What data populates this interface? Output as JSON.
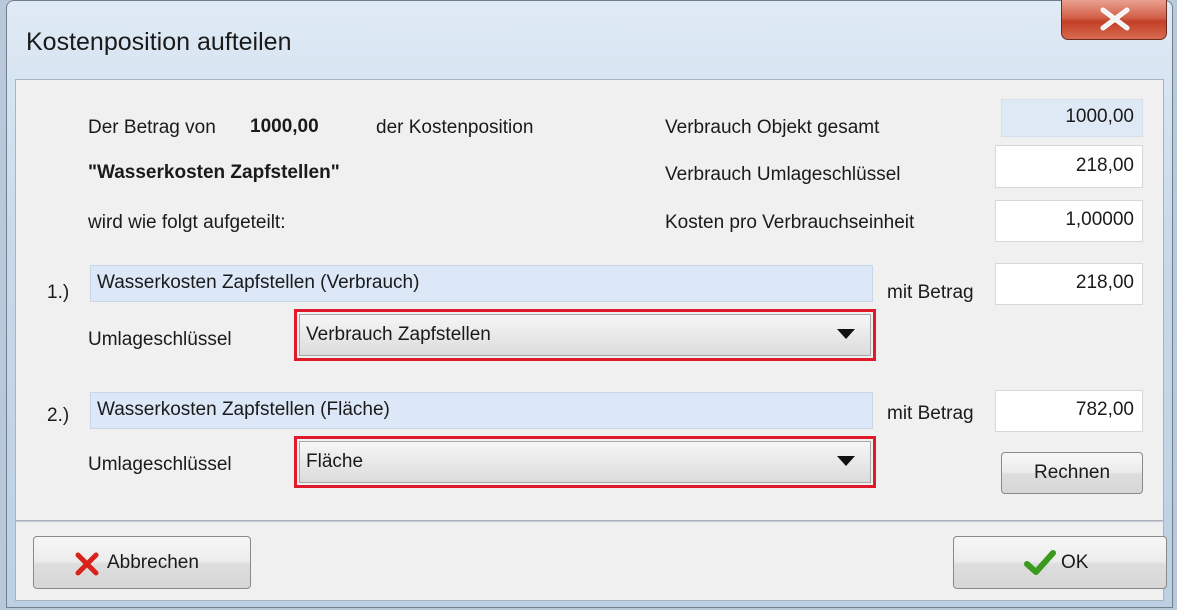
{
  "window": {
    "title": "Kostenposition aufteilen"
  },
  "intro": {
    "line1_prefix": "Der Betrag von",
    "amount": "1000,00",
    "line1_suffix": "der Kostenposition",
    "position_name": "\"Wasserkosten Zapfstellen\"",
    "line3": "wird wie folgt aufgeteilt:"
  },
  "summary": {
    "verbrauch_objekt_label": "Verbrauch Objekt gesamt",
    "verbrauch_objekt_value": "1000,00",
    "verbrauch_schluessel_label": "Verbrauch Umlageschlüssel",
    "verbrauch_schluessel_value": "218,00",
    "kosten_einheit_label": "Kosten pro Verbrauchseinheit",
    "kosten_einheit_value": "1,00000"
  },
  "split1": {
    "index": "1.)",
    "name": "Wasserkosten Zapfstellen (Verbrauch)",
    "amount_label": "mit Betrag",
    "amount": "218,00",
    "key_label": "Umlageschlüssel",
    "key_value": "Verbrauch Zapfstellen"
  },
  "split2": {
    "index": "2.)",
    "name": "Wasserkosten Zapfstellen (Fläche)",
    "amount_label": "mit Betrag",
    "amount": "782,00",
    "key_label": "Umlageschlüssel",
    "key_value": "Fläche"
  },
  "buttons": {
    "calculate": "Rechnen",
    "cancel": "Abbrechen",
    "ok": "OK"
  },
  "colors": {
    "highlight_frame": "#e01a2a",
    "readonly_field": "#dfe9f5",
    "ok_check": "#3a9a1e",
    "cancel_x": "#d8231a"
  },
  "icons": {
    "close": "close-icon",
    "cancel": "red-x-icon",
    "ok": "green-check-icon"
  }
}
